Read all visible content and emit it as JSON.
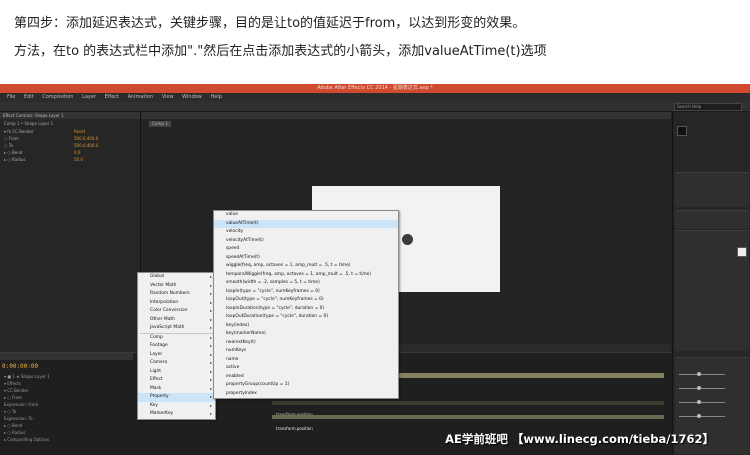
{
  "instructions": {
    "step": "第四步：添加延迟表达式，关键步骤，目的是让to的值延迟于from，以达到形变的效果。",
    "method": "方法，在to 的表达式栏中添加\".\"然后在点击添加表达式的小箭头，添加valueAtTime(t)选项"
  },
  "app": {
    "title": "Adobe After Effects CC 2014 - 星期表达式.aep *",
    "menu": [
      "File",
      "Edit",
      "Composition",
      "Layer",
      "Effect",
      "Animation",
      "View",
      "Window",
      "Help"
    ],
    "search_placeholder": "Search Help"
  },
  "project": {
    "tab": "Effect Controls: Shape Layer 1",
    "layer": "Comp 1 • Shape Layer 1",
    "props": [
      {
        "label": "▾ fx  CC Bender",
        "value": "Reset"
      },
      {
        "label": "      ○ From",
        "value": "500.0,400.0"
      },
      {
        "label": "      ○ To",
        "value": "500.0,400.0"
      },
      {
        "label": "    ▸ ○ Bend",
        "value": "0.0"
      },
      {
        "label": "    ▸ ○ Radius",
        "value": "50.0"
      }
    ]
  },
  "comp": {
    "sub_tab": "Comp 1"
  },
  "timeline": {
    "timecode": "0:00:00:00",
    "rows": [
      "▾ ■ 1   ★ Shape Layer 1",
      "  ▾ Effects",
      "    ▾ CC Bender",
      "      ▸ ○ From",
      "          Expression: From",
      "      ▾ ○ To",
      "          Expression: To",
      "      ▸ ○ Bend",
      "      ▸ ○ Radius",
      "    ▸ Compositing Options"
    ],
    "expression_text": "transform.position"
  },
  "menu_left": [
    {
      "label": "Global",
      "arrow": true
    },
    {
      "label": "Vector Math",
      "arrow": true
    },
    {
      "label": "Random Numbers",
      "arrow": true
    },
    {
      "label": "Interpolation",
      "arrow": true
    },
    {
      "label": "Color Conversion",
      "arrow": true
    },
    {
      "label": "Other Math",
      "arrow": true
    },
    {
      "label": "JavaScript Math",
      "arrow": true
    },
    {
      "label": "Comp",
      "arrow": true
    },
    {
      "label": "Footage",
      "arrow": true
    },
    {
      "label": "Layer",
      "arrow": true
    },
    {
      "label": "Camera",
      "arrow": true
    },
    {
      "label": "Light",
      "arrow": true
    },
    {
      "label": "Effect",
      "arrow": true
    },
    {
      "label": "Mask",
      "arrow": true
    },
    {
      "label": "Property",
      "arrow": true,
      "highlight": true
    },
    {
      "label": "Key",
      "arrow": true
    },
    {
      "label": "MarkerKey",
      "arrow": true
    }
  ],
  "menu_right": [
    {
      "label": "value"
    },
    {
      "label": "valueAtTime(t)",
      "highlight": true
    },
    {
      "label": "velocity"
    },
    {
      "label": "velocityAtTime(t)"
    },
    {
      "label": "speed"
    },
    {
      "label": "speedAtTime(t)"
    },
    {
      "label": "wiggle(freq, amp, octaves = 1, amp_mult = .5, t = time)"
    },
    {
      "label": "temporalWiggle(freq, amp, octaves = 1, amp_mult = .5, t = time)"
    },
    {
      "label": "smooth(width = .2, samples = 5, t = time)"
    },
    {
      "label": "loopIn(type = \"cycle\", numKeyframes = 0)"
    },
    {
      "label": "loopOut(type = \"cycle\", numKeyframes = 0)"
    },
    {
      "label": "loopInDuration(type = \"cycle\", duration = 0)"
    },
    {
      "label": "loopOutDuration(type = \"cycle\", duration = 0)"
    },
    {
      "label": "key(index)"
    },
    {
      "label": "key(markerName)"
    },
    {
      "label": "nearestKey(t)"
    },
    {
      "label": "numKeys"
    },
    {
      "label": "name"
    },
    {
      "label": "active"
    },
    {
      "label": "enabled"
    },
    {
      "label": "propertyGroup(countUp = 1)"
    },
    {
      "label": "propertyIndex"
    }
  ],
  "watermark": "AE学前班吧 【www.linecg.com/tieba/1762】",
  "colors": {
    "titlebar": "#cf4a2e",
    "timecode": "#f2b23a",
    "value": "#e0932f",
    "menu_highlight": "#cce4f7"
  }
}
